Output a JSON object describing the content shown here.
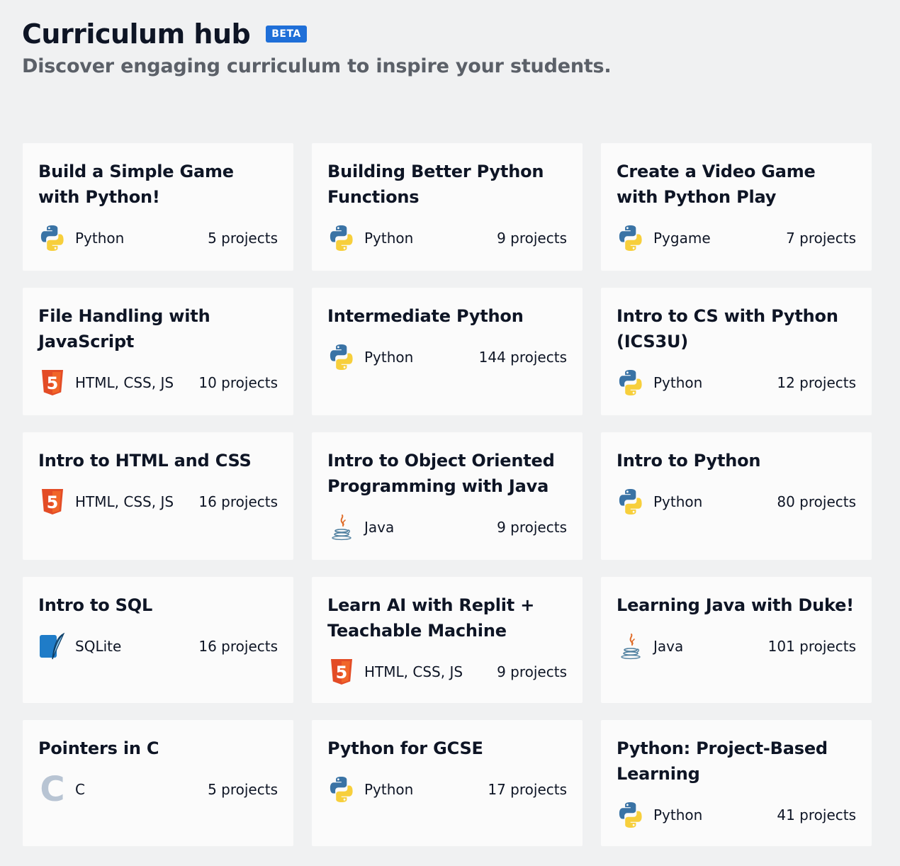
{
  "header": {
    "title": "Curriculum hub",
    "badge": "BETA",
    "subtitle": "Discover engaging curriculum to inspire your students."
  },
  "cards": [
    {
      "title": "Build a Simple Game with Python!",
      "lang": "Python",
      "icon": "python-icon",
      "count": "5 projects"
    },
    {
      "title": "Building Better Python Functions",
      "lang": "Python",
      "icon": "python-icon",
      "count": "9 projects"
    },
    {
      "title": "Create a Video Game with Python Play",
      "lang": "Pygame",
      "icon": "python-icon",
      "count": "7 projects"
    },
    {
      "title": "File Handling with JavaScript",
      "lang": "HTML, CSS, JS",
      "icon": "html5-icon",
      "count": "10 projects"
    },
    {
      "title": "Intermediate Python",
      "lang": "Python",
      "icon": "python-icon",
      "count": "144 projects"
    },
    {
      "title": "Intro to CS with Python (ICS3U)",
      "lang": "Python",
      "icon": "python-icon",
      "count": "12 projects"
    },
    {
      "title": "Intro to HTML and CSS",
      "lang": "HTML, CSS, JS",
      "icon": "html5-icon",
      "count": "16 projects"
    },
    {
      "title": "Intro to Object Oriented Programming with Java",
      "lang": "Java",
      "icon": "java-icon",
      "count": "9 projects"
    },
    {
      "title": "Intro to Python",
      "lang": "Python",
      "icon": "python-icon",
      "count": "80 projects"
    },
    {
      "title": "Intro to SQL",
      "lang": "SQLite",
      "icon": "sqlite-icon",
      "count": "16 projects"
    },
    {
      "title": "Learn AI with Replit + Teachable Machine",
      "lang": "HTML, CSS, JS",
      "icon": "html5-icon",
      "count": "9 projects"
    },
    {
      "title": "Learning Java with Duke!",
      "lang": "Java",
      "icon": "java-icon",
      "count": "101 projects"
    },
    {
      "title": "Pointers in C",
      "lang": "C",
      "icon": "c-icon",
      "count": "5 projects"
    },
    {
      "title": "Python for GCSE",
      "lang": "Python",
      "icon": "python-icon",
      "count": "17 projects"
    },
    {
      "title": "Python: Project-Based Learning",
      "lang": "Python",
      "icon": "python-icon",
      "count": "41 projects"
    }
  ],
  "colors": {
    "badge": "#1f6fd8",
    "python_blue": "#3a73a5",
    "python_yellow": "#f7cf3c",
    "html5_orange": "#e34c26",
    "sqlite_blue": "#1f7cc8",
    "java_red": "#e06d2a",
    "c_gray": "#b8c4d3"
  },
  "icon_letters": {
    "html5": "5",
    "c": "C"
  }
}
